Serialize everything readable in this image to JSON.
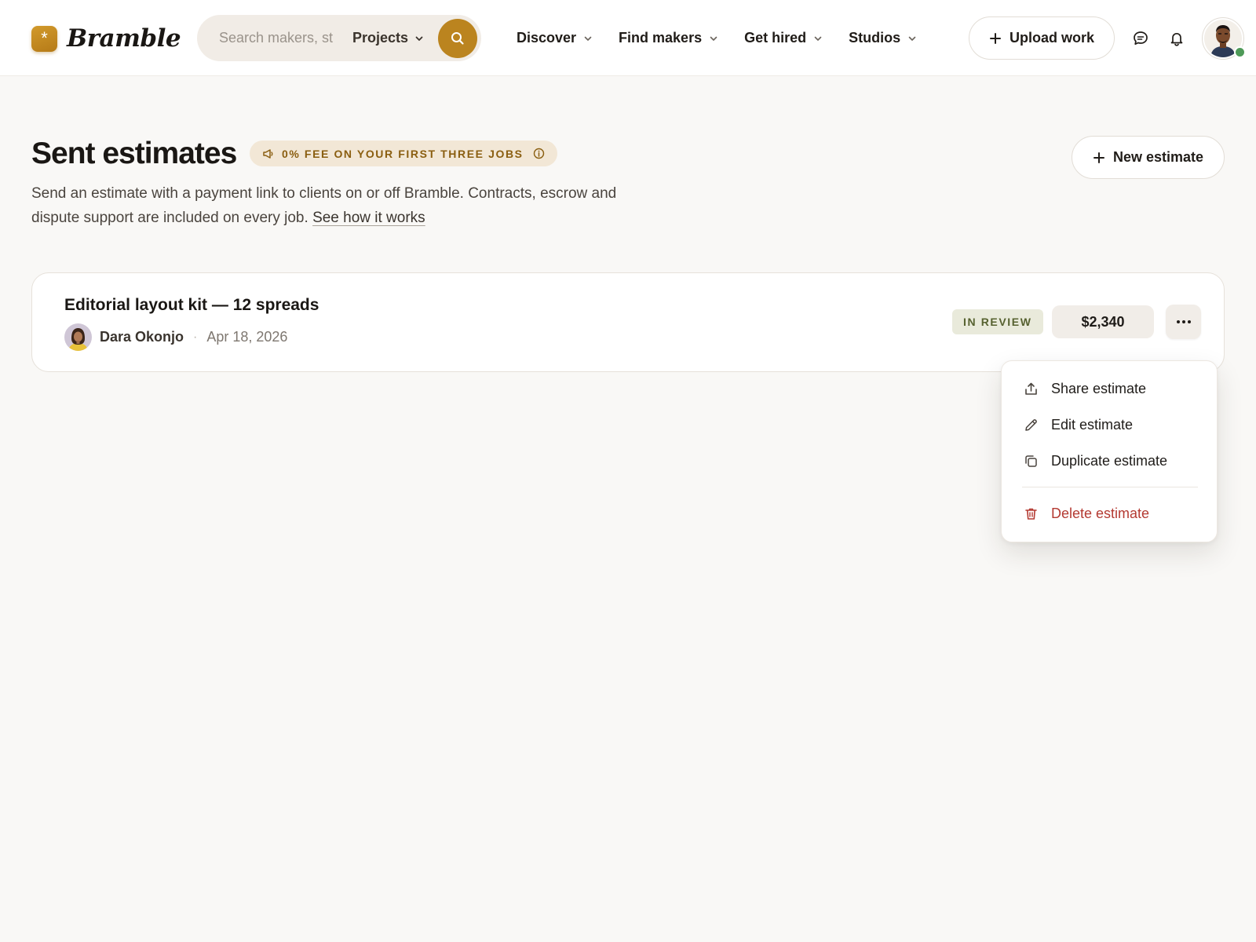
{
  "brand": {
    "name": "Bramble",
    "mark": "*"
  },
  "search": {
    "placeholder": "Search makers, studios...",
    "scope": "Projects"
  },
  "nav": [
    {
      "label": "Discover"
    },
    {
      "label": "Find makers"
    },
    {
      "label": "Get hired"
    },
    {
      "label": "Studios"
    }
  ],
  "header_actions": {
    "upload_label": "Upload work",
    "icons": [
      "chat-icon",
      "bell-icon",
      "user-avatar"
    ],
    "online": true
  },
  "page": {
    "title": "Sent estimates",
    "promo": "0% FEE ON YOUR FIRST THREE JOBS",
    "intro": "Send an estimate with a payment link to clients on or off Bramble. Contracts, escrow and dispute support are included on every job.",
    "intro_link": "See how it works",
    "new_estimate_label": "New estimate"
  },
  "estimates": [
    {
      "title": "Editorial layout kit — 12 spreads",
      "client": "Dara Okonjo",
      "separator": "·",
      "date": "Apr 18, 2026",
      "status": "IN REVIEW",
      "amount": "$2,340"
    }
  ],
  "menu": {
    "items": [
      {
        "label": "Share estimate",
        "icon": "share-icon"
      },
      {
        "label": "Edit estimate",
        "icon": "pencil-icon"
      },
      {
        "label": "Duplicate estimate",
        "icon": "copy-icon"
      },
      {
        "label": "Delete estimate",
        "icon": "trash-icon",
        "danger": true
      }
    ]
  },
  "colors": {
    "accent": "#bb841f",
    "background": "#f9f8f6",
    "status_bg": "#e9eadb",
    "status_text": "#56612f",
    "danger": "#b43a32",
    "online": "#4e9a58"
  }
}
